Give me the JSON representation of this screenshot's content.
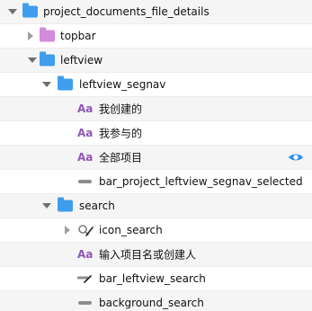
{
  "layers": {
    "items": [
      {
        "label": "project_documents_file_details"
      },
      {
        "label": "topbar"
      },
      {
        "label": "leftview"
      },
      {
        "label": "leftview_segnav"
      },
      {
        "label": "我创建的",
        "icon_text": "Aa"
      },
      {
        "label": "我参与的",
        "icon_text": "Aa"
      },
      {
        "label": "全部项目",
        "icon_text": "Aa"
      },
      {
        "label": "bar_project_leftview_segnav_selected"
      },
      {
        "label": "search"
      },
      {
        "label": "icon_search"
      },
      {
        "label": "输入项目名或创建人",
        "icon_text": "Aa"
      },
      {
        "label": "bar_leftview_search"
      },
      {
        "label": "background_search"
      }
    ]
  },
  "colors": {
    "folder": "#3f9ded",
    "group_folder": "#d58bdb",
    "text_layer_icon": "#8f57b8",
    "visibility_icon": "#2d8fe8",
    "alternate_row": "#f5f5f5"
  },
  "icons": {
    "folder": "folder-icon",
    "group_folder": "group-folder-icon",
    "text_layer": "text-layer-icon",
    "rectangle_layer": "rectangle-layer-icon",
    "line_layer": "line-layer-icon",
    "search_symbol": "search-symbol-icon",
    "visibility": "eye-icon",
    "expanded": "chevron-down-icon",
    "collapsed": "chevron-right-icon"
  }
}
